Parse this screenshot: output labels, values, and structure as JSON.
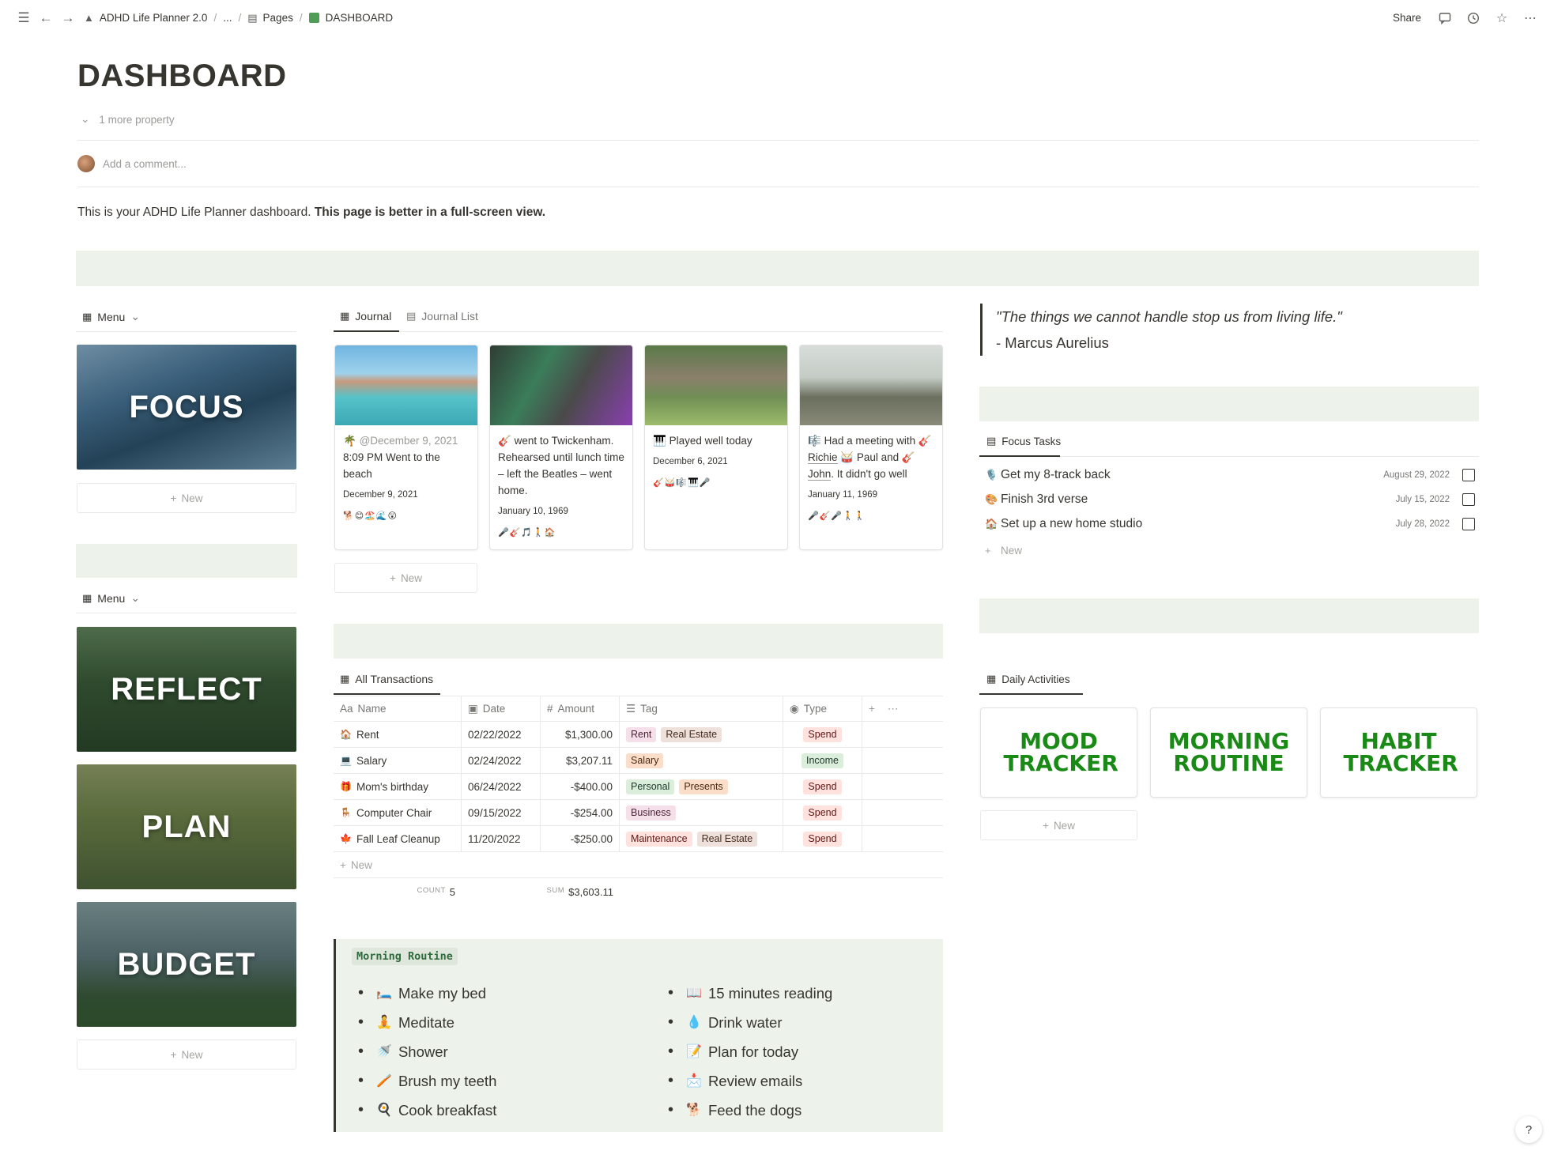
{
  "breadcrumb": {
    "workspace": "ADHD Life Planner 2.0",
    "ellipsis": "...",
    "pages": "Pages",
    "current": "DASHBOARD"
  },
  "topbar": {
    "share": "Share"
  },
  "page": {
    "title": "DASHBOARD",
    "more_property": "1 more property",
    "comment_placeholder": "Add a comment...",
    "intro_plain": "This is your ADHD Life Planner dashboard.",
    "intro_bold": "This page is better in a full-screen view."
  },
  "left": {
    "menu1_label": "Menu",
    "focus": "FOCUS",
    "new1": "New",
    "menu2_label": "Menu",
    "reflect": "REFLECT",
    "plan": "PLAN",
    "budget": "BUDGET",
    "new2": "New"
  },
  "journal": {
    "tab1": "Journal",
    "tab2": "Journal List",
    "new": "New",
    "cards": [
      {
        "icon": "🌴",
        "mention": "@December 9, 2021",
        "text": "8:09 PM Went to the beach",
        "date": "December 9, 2021",
        "emoji": "🐕😊🏖️🌊😲"
      },
      {
        "icon": "🎸",
        "text": "went to Twickenham. Rehearsed until lunch time – left the Beatles – went home.",
        "date": "January 10, 1969",
        "emoji": "🎤🎸🎵🚶🏠"
      },
      {
        "icon": "🎹",
        "text": "Played well today",
        "date": "December 6, 2021",
        "emoji": "🎸🥁🎼🎹🎤"
      },
      {
        "icon": "🎼",
        "text_pre": "Had a meeting with",
        "p1": "Richie",
        "p2": "Paul",
        "and": "and",
        "p3": "John",
        "text_post": ". It didn't go well",
        "date": "January 11, 1969",
        "emoji": "🎤🎸🎤🚶🚶"
      }
    ]
  },
  "transactions": {
    "tab": "All Transactions",
    "headers": {
      "name": "Name",
      "date": "Date",
      "amount": "Amount",
      "tag": "Tag",
      "type": "Type"
    },
    "rows": [
      {
        "icon": "🏠",
        "name": "Rent",
        "date": "02/22/2022",
        "amount": "$1,300.00",
        "tags": [
          "Rent",
          "Real Estate"
        ],
        "type": "Spend"
      },
      {
        "icon": "💻",
        "name": "Salary",
        "date": "02/24/2022",
        "amount": "$3,207.11",
        "tags": [
          "Salary"
        ],
        "type": "Income"
      },
      {
        "icon": "🎁",
        "name": "Mom's birthday",
        "date": "06/24/2022",
        "amount": "-$400.00",
        "tags": [
          "Personal",
          "Presents"
        ],
        "type": "Spend"
      },
      {
        "icon": "🪑",
        "name": "Computer Chair",
        "date": "09/15/2022",
        "amount": "-$254.00",
        "tags": [
          "Business"
        ],
        "type": "Spend"
      },
      {
        "icon": "🍁",
        "name": "Fall Leaf Cleanup",
        "date": "11/20/2022",
        "amount": "-$250.00",
        "tags": [
          "Maintenance",
          "Real Estate"
        ],
        "type": "Spend"
      }
    ],
    "new": "New",
    "count_label": "COUNT",
    "count": "5",
    "sum_label": "SUM",
    "sum": "$3,603.11"
  },
  "routine": {
    "label": "Morning Routine",
    "col1": [
      {
        "e": "🛏️",
        "t": "Make my bed"
      },
      {
        "e": "🧘",
        "t": "Meditate"
      },
      {
        "e": "🚿",
        "t": "Shower"
      },
      {
        "e": "🪥",
        "t": "Brush my teeth"
      },
      {
        "e": "🍳",
        "t": "Cook breakfast"
      }
    ],
    "col2": [
      {
        "e": "📖",
        "t": "15 minutes reading"
      },
      {
        "e": "💧",
        "t": "Drink water"
      },
      {
        "e": "📝",
        "t": "Plan for today"
      },
      {
        "e": "📩",
        "t": "Review emails"
      },
      {
        "e": "🐕",
        "t": "Feed the dogs"
      }
    ]
  },
  "quote": {
    "text": "\"The things we cannot handle stop us from living life.\"",
    "author": "- Marcus Aurelius"
  },
  "focus_tasks": {
    "tab": "Focus Tasks",
    "items": [
      {
        "e": "🎙️",
        "t": "Get my 8-track back",
        "d": "August 29, 2022"
      },
      {
        "e": "🎨",
        "t": "Finish 3rd verse",
        "d": "July 15, 2022"
      },
      {
        "e": "🏠",
        "t": "Set up a new home studio",
        "d": "July 28, 2022"
      }
    ],
    "new": "New"
  },
  "daily": {
    "tab": "Daily Activities",
    "cards": [
      "MOOD TRACKER",
      "MORNING ROUTINE",
      "HABIT TRACKER"
    ],
    "new": "New"
  },
  "help": "?"
}
